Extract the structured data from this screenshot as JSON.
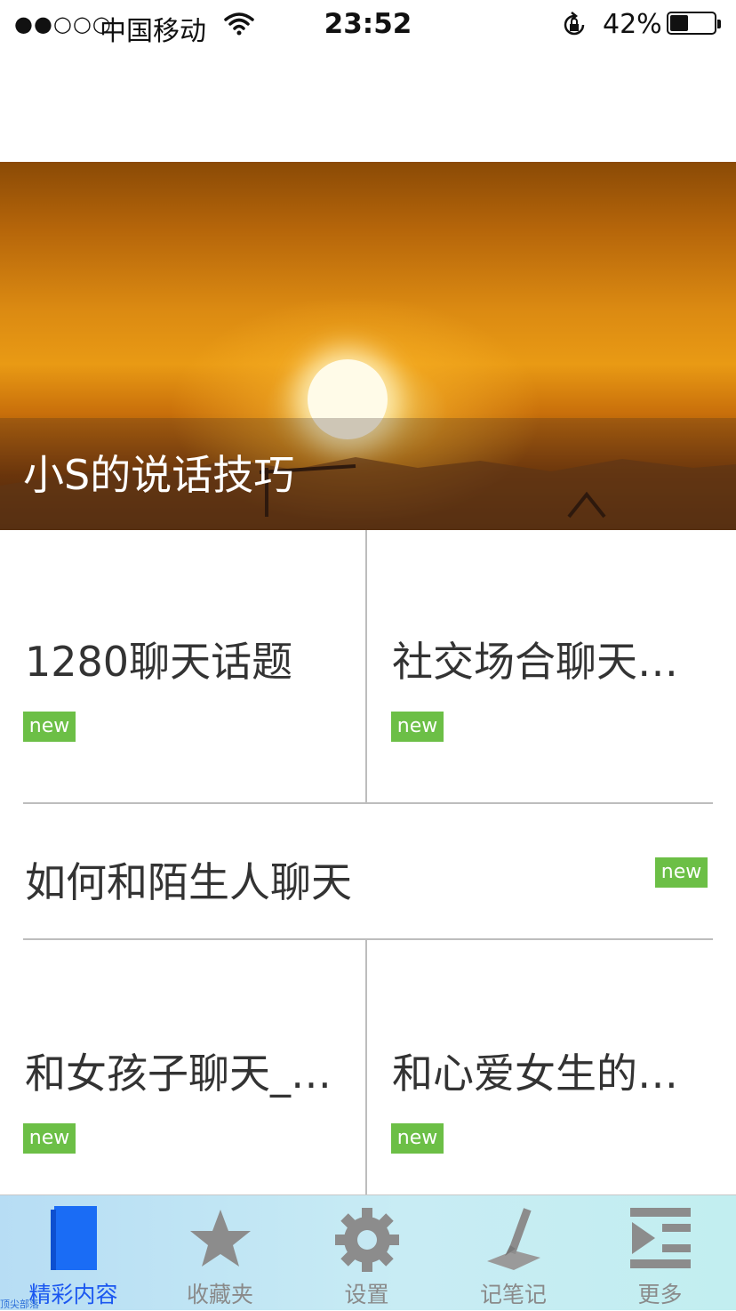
{
  "status_bar": {
    "signal": "●●○○○",
    "carrier": "中国移动",
    "time": "23:52",
    "battery_percent": "42%",
    "battery_level": 0.42
  },
  "hero": {
    "caption": "小S的说话技巧"
  },
  "grid": {
    "row1": [
      {
        "title": "1280聊天话题",
        "badge": "new"
      },
      {
        "title": "社交场合聊天…",
        "badge": "new"
      }
    ],
    "row2": {
      "title": "如何和陌生人聊天",
      "badge": "new"
    },
    "row3": [
      {
        "title": "和女孩子聊天_…",
        "badge": "new"
      },
      {
        "title": "和心爱女生的…",
        "badge": "new"
      }
    ]
  },
  "tab_bar": {
    "tabs": [
      {
        "label": "精彩内容",
        "icon": "book-icon",
        "active": true
      },
      {
        "label": "收藏夹",
        "icon": "star-icon",
        "active": false
      },
      {
        "label": "设置",
        "icon": "gear-icon",
        "active": false
      },
      {
        "label": "记笔记",
        "icon": "pen-icon",
        "active": false
      },
      {
        "label": "更多",
        "icon": "more-list-icon",
        "active": false
      }
    ],
    "active_color": "#1b57f0",
    "inactive_color": "#8a8a8a"
  },
  "watermark": "顶尖部落"
}
